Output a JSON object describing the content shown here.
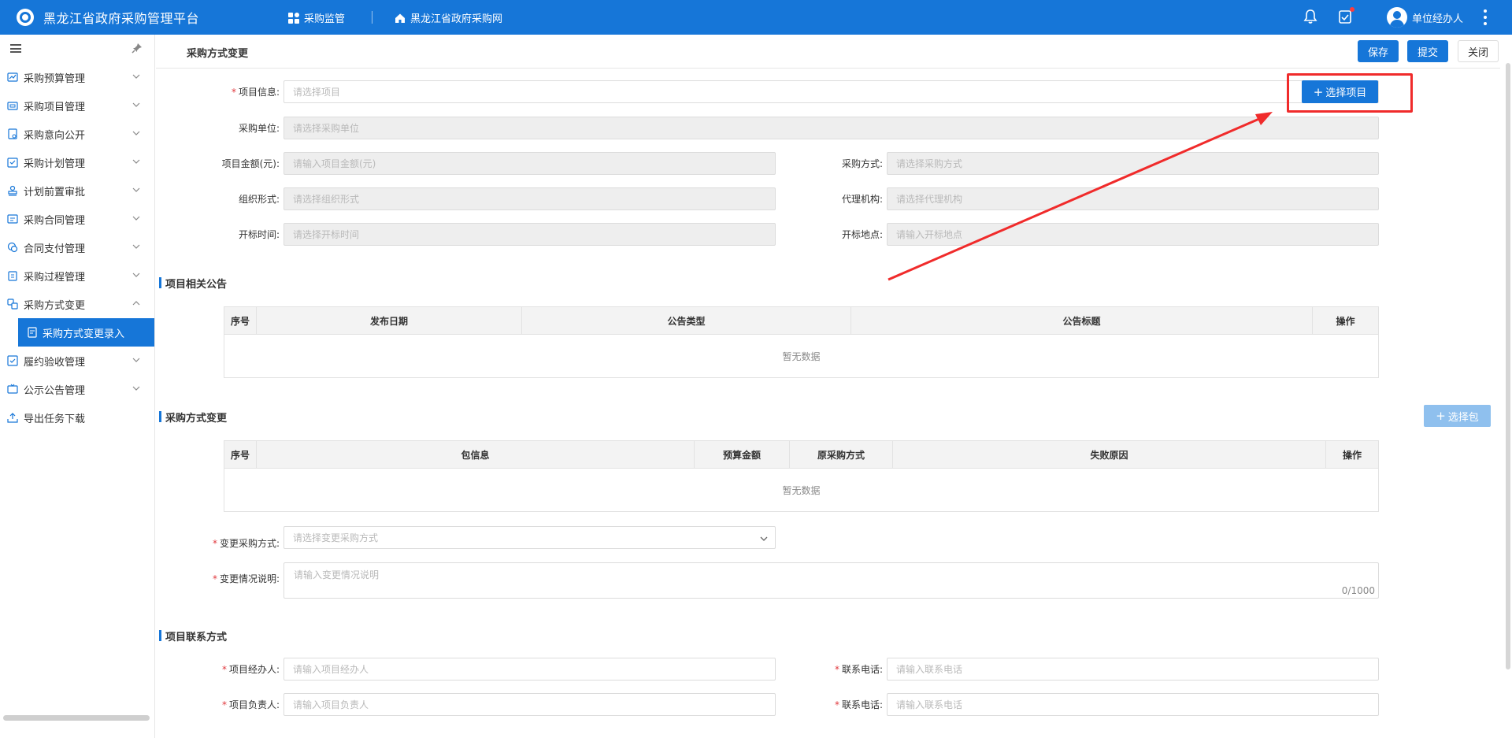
{
  "header": {
    "app_title": "黑龙江省政府采购管理平台",
    "nav_supervision": "采购监管",
    "nav_website": "黑龙江省政府采购网",
    "user_name": "单位经办人"
  },
  "sidebar": {
    "items": [
      {
        "label": "采购预算管理"
      },
      {
        "label": "采购项目管理"
      },
      {
        "label": "采购意向公开"
      },
      {
        "label": "采购计划管理"
      },
      {
        "label": "计划前置审批"
      },
      {
        "label": "采购合同管理"
      },
      {
        "label": "合同支付管理"
      },
      {
        "label": "采购过程管理"
      },
      {
        "label": "采购方式变更"
      },
      {
        "label": "履约验收管理"
      },
      {
        "label": "公示公告管理"
      },
      {
        "label": "导出任务下载"
      }
    ],
    "active_sub": "采购方式变更录入"
  },
  "page": {
    "title": "采购方式变更",
    "save": "保存",
    "submit": "提交",
    "close": "关闭"
  },
  "form": {
    "project_info_label": "项目信息:",
    "project_info_ph": "请选择项目",
    "select_project_btn": "选择项目",
    "unit_label": "采购单位:",
    "unit_ph": "请选择采购单位",
    "amount_label": "项目金额(元):",
    "amount_ph": "请输入项目金额(元)",
    "method_label": "采购方式:",
    "method_ph": "请选择采购方式",
    "org_label": "组织形式:",
    "org_ph": "请选择组织形式",
    "agency_label": "代理机构:",
    "agency_ph": "请选择代理机构",
    "open_time_label": "开标时间:",
    "open_time_ph": "请选择开标时间",
    "open_place_label": "开标地点:",
    "open_place_ph": "请输入开标地点"
  },
  "announcements": {
    "title": "项目相关公告",
    "columns": [
      "序号",
      "发布日期",
      "公告类型",
      "公告标题",
      "操作"
    ],
    "empty": "暂无数据"
  },
  "method_change": {
    "title": "采购方式变更",
    "select_pkg_btn": "选择包",
    "columns": [
      "序号",
      "包信息",
      "预算金额",
      "原采购方式",
      "失败原因",
      "操作"
    ],
    "empty": "暂无数据",
    "change_method_label": "变更采购方式:",
    "change_method_ph": "请选择变更采购方式",
    "desc_label": "变更情况说明:",
    "desc_ph": "请输入变更情况说明",
    "desc_counter": "0/1000"
  },
  "contact": {
    "title": "项目联系方式",
    "handler_label": "项目经办人:",
    "handler_ph": "请输入项目经办人",
    "phone1_label": "联系电话:",
    "phone1_ph": "请输入联系电话",
    "leader_label": "项目负责人:",
    "leader_ph": "请输入项目负责人",
    "phone2_label": "联系电话:",
    "phone2_ph": "请输入联系电话"
  },
  "colors": {
    "brand": "#1676d8",
    "annotation": "#f02b2b"
  }
}
